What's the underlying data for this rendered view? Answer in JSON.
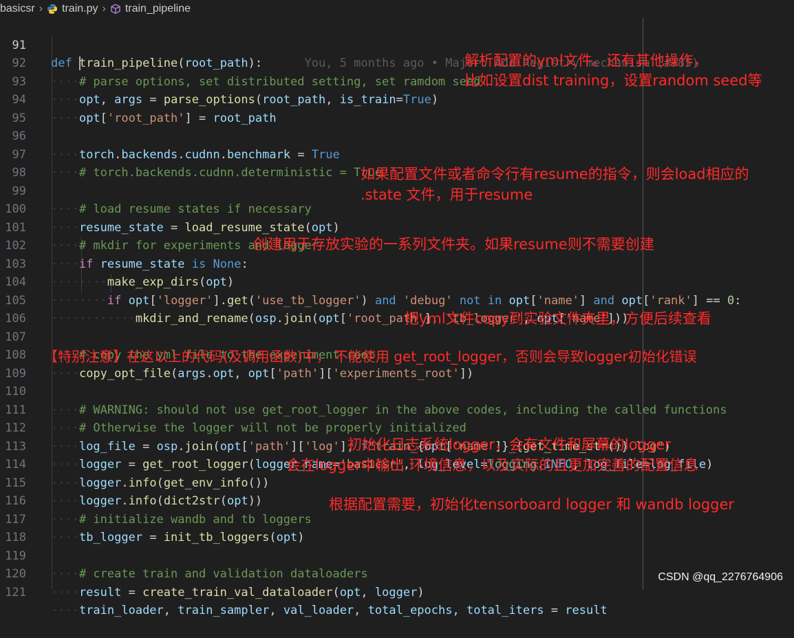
{
  "breadcrumb": {
    "folder": "basicsr",
    "file": "train.py",
    "symbol": "train_pipeline"
  },
  "colors": {
    "background": "#1f1f1f",
    "annotation": "#ff2a2a",
    "keyword": "#569cd6",
    "function": "#dcdcaa",
    "variable": "#9cdcfe",
    "string": "#ce9178",
    "comment": "#6a9955"
  },
  "blame": "You, 5 months ago • Major: Add Registry mechanism (#385)",
  "lines": [
    {
      "n": "91"
    },
    {
      "n": "92"
    },
    {
      "n": "93"
    },
    {
      "n": "94"
    },
    {
      "n": "95"
    },
    {
      "n": "96"
    },
    {
      "n": "97"
    },
    {
      "n": "98"
    },
    {
      "n": "99"
    },
    {
      "n": "100"
    },
    {
      "n": "101"
    },
    {
      "n": "102"
    },
    {
      "n": "103"
    },
    {
      "n": "104"
    },
    {
      "n": "105"
    },
    {
      "n": "106"
    },
    {
      "n": "107"
    },
    {
      "n": "108"
    },
    {
      "n": "109"
    },
    {
      "n": "110"
    },
    {
      "n": "111"
    },
    {
      "n": "112"
    },
    {
      "n": "113"
    },
    {
      "n": "114"
    },
    {
      "n": "115"
    },
    {
      "n": "116"
    },
    {
      "n": "117"
    },
    {
      "n": "118"
    },
    {
      "n": "119"
    },
    {
      "n": "120"
    },
    {
      "n": "121"
    }
  ],
  "annotations": {
    "a1": "解析配置的yml文件。还有其他操作，",
    "a2": "比如设置dist training，设置random seed等",
    "a3": "如果配置文件或者命令行有resume的指令，则会load相应的",
    "a4": ".state 文件，用于resume",
    "a5": "创建用于存放实验的一系列文件夹。如果resume则不需要创建",
    "a6": "把yml文件copy到实验文件夹里，方便后续查看",
    "a7": "【特别注意】在这以上的代码(及调用函数)中， 不能使用 get_root_logger，否则会导致logger初始化错误",
    "a8": "初始化日志系统logger，会有文件和屏幕的logger",
    "a9": "会在logger中输出 环境信息，以及实际的且更加完善的配置信息",
    "a10": "根据配置需要，初始化tensorboard logger 和 wandb logger"
  },
  "watermark": "CSDN @qq_2276764906"
}
